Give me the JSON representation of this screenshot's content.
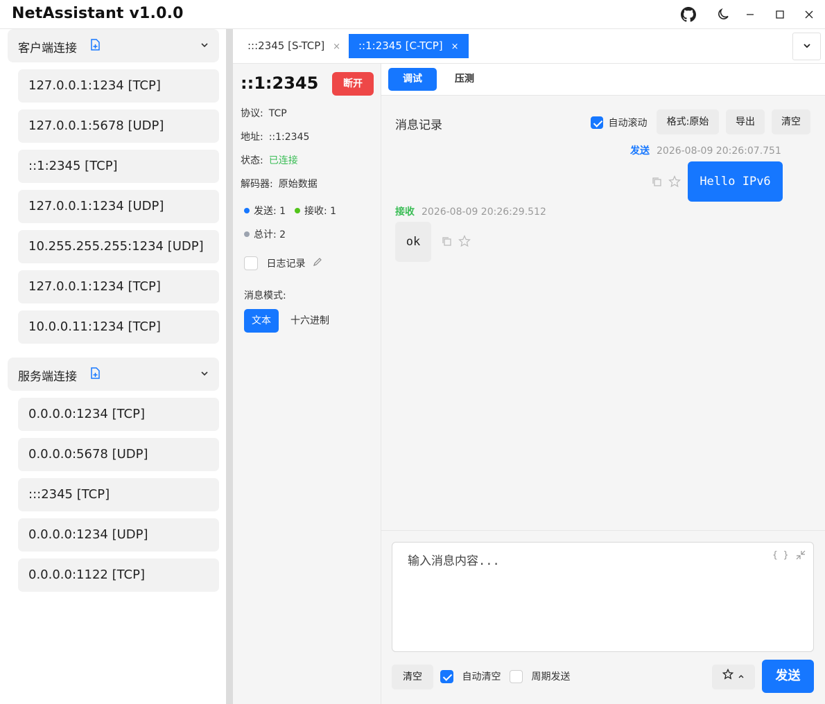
{
  "app": {
    "title": "NetAssistant v1.0.0"
  },
  "window_controls": [
    "github-icon",
    "moon-icon",
    "minimize-icon",
    "maximize-icon",
    "close-icon"
  ],
  "sidebar": {
    "client_group": {
      "title": "客户端连接",
      "items": [
        "127.0.0.1:1234 [TCP]",
        "127.0.0.1:5678 [UDP]",
        "::1:2345 [TCP]",
        "127.0.0.1:1234 [UDP]",
        "10.255.255.255:1234 [UDP]",
        "127.0.0.1:1234 [TCP]",
        "10.0.0.11:1234 [TCP]"
      ]
    },
    "server_group": {
      "title": "服务端连接",
      "items": [
        "0.0.0.0:1234 [TCP]",
        "0.0.0.0:5678 [UDP]",
        ":::2345 [TCP]",
        "0.0.0.0:1234 [UDP]",
        "0.0.0.0:1122 [TCP]"
      ]
    }
  },
  "tabs": [
    {
      "label": ":::2345 [S-TCP]",
      "close": "×",
      "active": false
    },
    {
      "label": "::1:2345 [C-TCP]",
      "close": "×",
      "active": true
    }
  ],
  "info": {
    "title": "::1:2345",
    "disconnect_label": "断开",
    "protocol_label": "协议:",
    "protocol_value": "TCP",
    "address_label": "地址:",
    "address_value": "::1:2345",
    "status_label": "状态:",
    "status_value": "已连接",
    "decoder_label": "解码器:",
    "decoder_value": "原始数据",
    "sent_label": "发送: 1",
    "recv_label": "接收: 1",
    "total_label": "总计: 2",
    "log_label": "日志记录",
    "mode_label": "消息模式:",
    "mode_text": "文本",
    "mode_hex": "十六进制",
    "colors": {
      "sent": "#1677ff",
      "recv": "#52c41a",
      "total": "#9ca3af",
      "connected": "#3bbd56",
      "disconnect": "#ee4747"
    }
  },
  "main": {
    "subtabs": [
      "调试",
      "压测"
    ],
    "log_title": "消息记录",
    "auto_scroll_label": "自动滚动",
    "format_label": "格式:原始",
    "export_label": "导出",
    "clear_label": "清空",
    "messages": [
      {
        "direction": "发送",
        "time": "2026-08-09 20:26:07.751",
        "content": "Hello IPv6"
      },
      {
        "direction": "接收",
        "time": "2026-08-09 20:26:29.512",
        "content": "ok"
      }
    ]
  },
  "input": {
    "placeholder": "输入消息内容...",
    "clear_label": "清空",
    "auto_clear_label": "自动清空",
    "periodic_label": "周期发送",
    "send_label": "发送"
  }
}
